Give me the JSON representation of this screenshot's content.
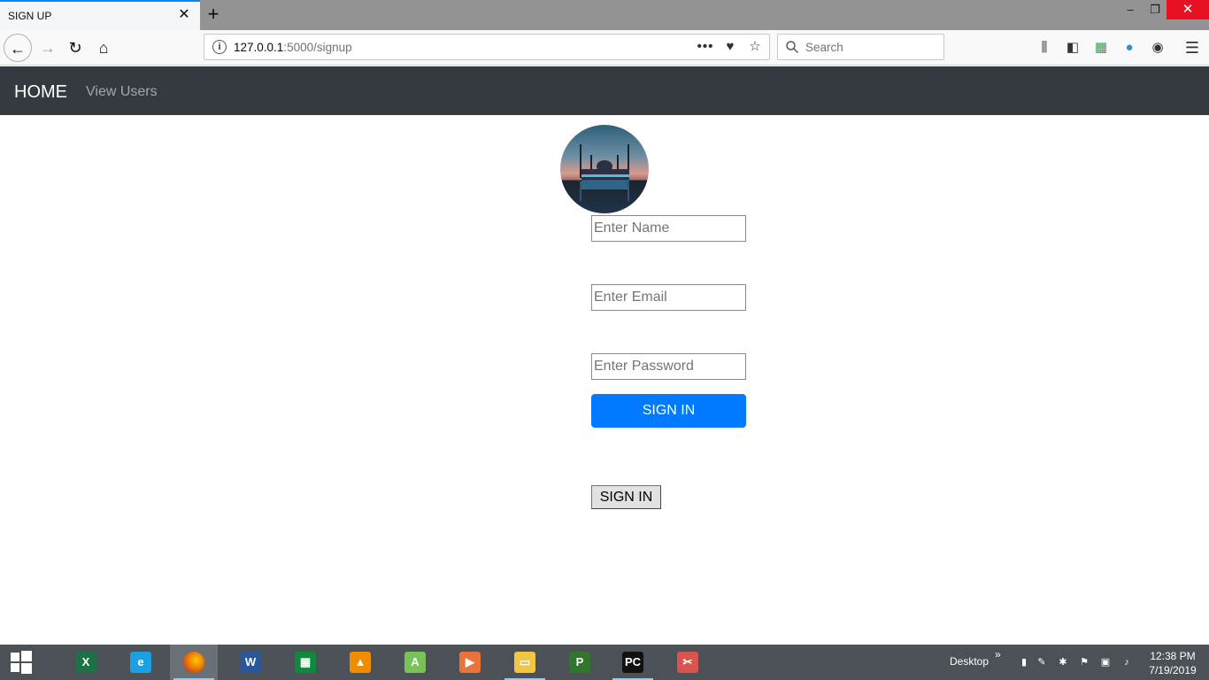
{
  "browser": {
    "tab_title": "SIGN UP",
    "tab_close": "✕",
    "new_tab": "+",
    "window_controls": {
      "minimize": "–",
      "maximize": "❐",
      "close": "✕"
    },
    "url_host": "127.0.0.1",
    "url_rest": ":5000/signup",
    "search_placeholder": "Search",
    "icons": {
      "back": "←",
      "forward": "→",
      "reload": "↻",
      "home": "⌂",
      "info": "i",
      "more": "•••",
      "pocket": "♥",
      "star": "☆",
      "library": "⫼",
      "sidebar": "◧",
      "ext1": "▦",
      "ext2": "●",
      "account": "◉",
      "menu": "☰"
    }
  },
  "site": {
    "brand": "HOME",
    "nav_link": "View Users"
  },
  "form": {
    "name_placeholder": "Enter Name",
    "email_placeholder": "Enter Email",
    "password_placeholder": "Enter Password",
    "primary_button": "SIGN IN",
    "secondary_button": "SIGN IN"
  },
  "taskbar": {
    "apps": [
      {
        "name": "excel",
        "glyph": "X",
        "color": "#1e7145"
      },
      {
        "name": "internet-explorer",
        "glyph": "e",
        "color": "#1ba1e2"
      },
      {
        "name": "firefox",
        "glyph": "",
        "color": "#e66000"
      },
      {
        "name": "word",
        "glyph": "W",
        "color": "#2b579a"
      },
      {
        "name": "store",
        "glyph": "▦",
        "color": "#10893e"
      },
      {
        "name": "vlc",
        "glyph": "▲",
        "color": "#f08c00"
      },
      {
        "name": "android-studio",
        "glyph": "A",
        "color": "#78c257"
      },
      {
        "name": "media-player",
        "glyph": "▶",
        "color": "#e8743b"
      },
      {
        "name": "file-explorer",
        "glyph": "▭",
        "color": "#f4c542"
      },
      {
        "name": "project",
        "glyph": "P",
        "color": "#31752f"
      },
      {
        "name": "pycharm",
        "glyph": "PC",
        "color": "#111111"
      },
      {
        "name": "snipping-tool",
        "glyph": "✂",
        "color": "#d9534f"
      }
    ],
    "tray_label": "Desktop",
    "tray_chevron": "»",
    "time": "12:38 PM",
    "date": "7/19/2019"
  }
}
